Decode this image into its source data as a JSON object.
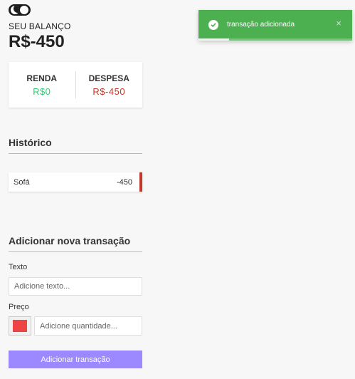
{
  "theme_toggle": {
    "icon": "moon-icon"
  },
  "balance": {
    "label": "SEU BALANÇO",
    "value": "R$-450"
  },
  "summary": {
    "income_label": "RENDA",
    "income_value": "R$0",
    "expense_label": "DESPESA",
    "expense_value": "R$-450"
  },
  "history": {
    "title": "Histórico",
    "items": [
      {
        "text": "Sofá",
        "amount": "-450",
        "type": "expense"
      }
    ]
  },
  "form": {
    "title": "Adicionar nova transação",
    "text_label": "Texto",
    "text_placeholder": "Adicione texto...",
    "price_label": "Preço",
    "price_placeholder": "Adicione quantidade...",
    "color_value": "#ee4444",
    "submit_label": "Adicionar transação"
  },
  "toast": {
    "message": "transação adicionada",
    "close_glyph": "×",
    "progress": 0.2,
    "icon": "check-circle-icon"
  },
  "colors": {
    "income": "#2ecc71",
    "expense": "#c0392b",
    "accent": "#9c88ff",
    "toast_bg": "#4caf50"
  }
}
